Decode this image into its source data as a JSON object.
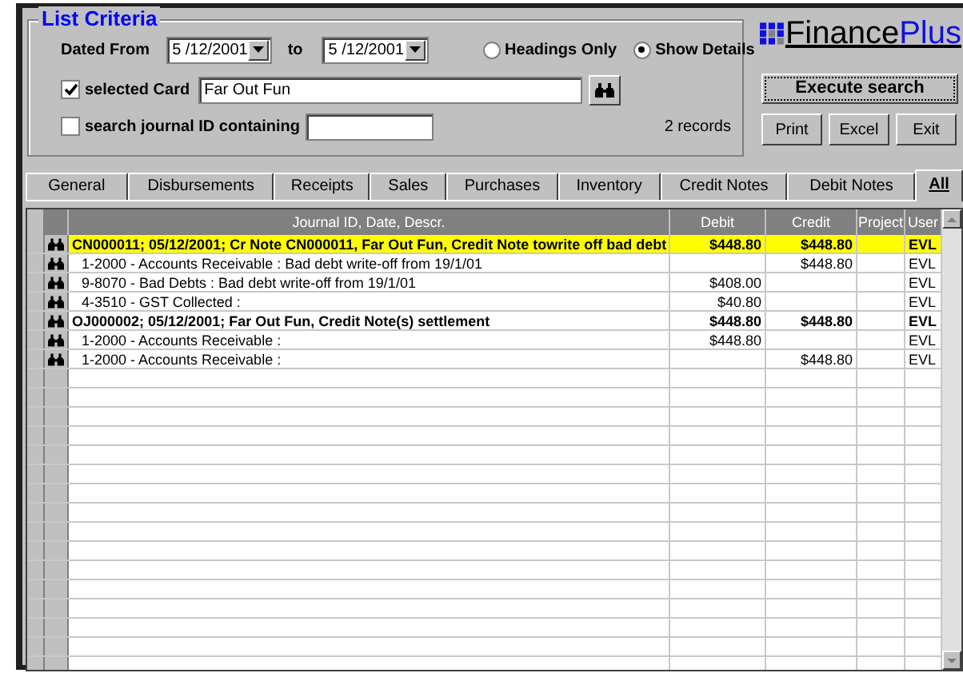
{
  "criteria": {
    "title": "List Criteria",
    "dated_from_label": "Dated From",
    "date_from": "5 /12/2001",
    "to_label": "to",
    "date_to": "5 /12/2001",
    "view_options": [
      {
        "label": "Headings Only",
        "selected": false
      },
      {
        "label": "Show Details",
        "selected": true
      }
    ],
    "card_filter": {
      "label": "selected Card",
      "checked": true,
      "value": "Far Out Fun"
    },
    "journal_filter": {
      "label": "search journal ID containing",
      "checked": false
    },
    "record_count": "2 records"
  },
  "logo": {
    "part_1": "Finance",
    "part_2": "Plus"
  },
  "execute_button": "Execute search",
  "buttons": [
    "Print",
    "Excel",
    "Exit"
  ],
  "tabs": [
    {
      "label": "General",
      "selected": false
    },
    {
      "label": "Disbursements",
      "selected": false
    },
    {
      "label": "Receipts",
      "selected": false
    },
    {
      "label": "Sales",
      "selected": false
    },
    {
      "label": "Purchases",
      "selected": false
    },
    {
      "label": "Inventory",
      "selected": false
    },
    {
      "label": "Credit Notes",
      "selected": false
    },
    {
      "label": "Debit Notes",
      "selected": false
    },
    {
      "label": "All",
      "selected": true
    }
  ],
  "table": {
    "columns": [
      "Journal ID, Date, Descr.",
      "Debit",
      "Credit",
      "Project",
      "User"
    ],
    "rows": [
      {
        "kind": "heading",
        "selected": true,
        "cells": [
          "CN000011; 05/12/2001; Cr Note CN000011, Far Out Fun, Credit Note towrite off bad debt",
          "$448.80",
          "$448.80",
          "EVL"
        ]
      },
      {
        "kind": "detail",
        "selected": false,
        "cells": [
          "1-2000 - Accounts Receivable : Bad debt write-off from 19/1/01",
          "",
          "$448.80",
          "EVL"
        ]
      },
      {
        "kind": "detail",
        "selected": false,
        "cells": [
          "9-8070 - Bad Debts : Bad debt write-off from 19/1/01",
          "$408.00",
          "",
          "EVL"
        ]
      },
      {
        "kind": "detail",
        "selected": false,
        "cells": [
          "4-3510 - GST Collected :",
          "$40.80",
          "",
          "EVL"
        ]
      },
      {
        "kind": "heading",
        "selected": false,
        "cells": [
          "OJ000002; 05/12/2001; Far Out Fun, Credit Note(s) settlement",
          "$448.80",
          "$448.80",
          "EVL"
        ]
      },
      {
        "kind": "detail",
        "selected": false,
        "cells": [
          "1-2000 - Accounts Receivable :",
          "$448.80",
          "",
          "EVL"
        ]
      },
      {
        "kind": "detail",
        "selected": false,
        "cells": [
          "1-2000 - Accounts Receivable :",
          "",
          "$448.80",
          "EVL"
        ]
      }
    ]
  }
}
